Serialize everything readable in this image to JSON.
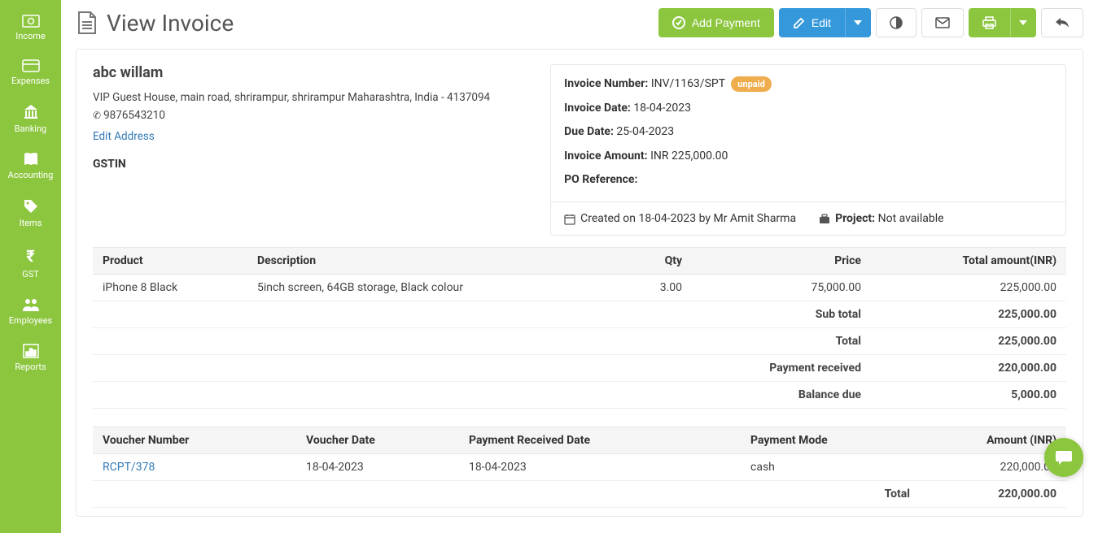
{
  "sidebar": {
    "items": [
      {
        "icon": "money",
        "label": "Income"
      },
      {
        "icon": "card",
        "label": "Expenses"
      },
      {
        "icon": "bank",
        "label": "Banking"
      },
      {
        "icon": "book",
        "label": "Accounting"
      },
      {
        "icon": "tag",
        "label": "Items"
      },
      {
        "icon": "rupee",
        "label": "GST"
      },
      {
        "icon": "users",
        "label": "Employees"
      },
      {
        "icon": "chart",
        "label": "Reports"
      }
    ]
  },
  "header": {
    "title": "View Invoice",
    "add_payment": "Add Payment",
    "edit": "Edit"
  },
  "customer": {
    "name": "abc willam",
    "address": "VIP Guest House, main road, shrirampur, shrirampur Maharashtra, India - 4137094",
    "phone": "9876543210",
    "edit_address": "Edit Address",
    "gstin_label": "GSTIN"
  },
  "invoice": {
    "number_label": "Invoice Number:",
    "number": "INV/1163/SPT",
    "status": "unpaid",
    "date_label": "Invoice Date:",
    "date": "18-04-2023",
    "due_label": "Due Date:",
    "due": "25-04-2023",
    "amount_label": "Invoice Amount:",
    "amount": "INR 225,000.00",
    "po_label": "PO Reference:",
    "po": "",
    "created_text": "Created on 18-04-2023 by Mr Amit Sharma",
    "project_label": "Project:",
    "project_value": "Not available"
  },
  "products": {
    "headers": {
      "product": "Product",
      "description": "Description",
      "qty": "Qty",
      "price": "Price",
      "total": "Total amount(INR)"
    },
    "rows": [
      {
        "product": "iPhone 8 Black",
        "description": "5inch screen, 64GB storage, Black colour",
        "qty": "3.00",
        "price": "75,000.00",
        "total": "225,000.00"
      }
    ],
    "summary": [
      {
        "label": "Sub total",
        "value": "225,000.00"
      },
      {
        "label": "Total",
        "value": "225,000.00"
      },
      {
        "label": "Payment received",
        "value": "220,000.00"
      },
      {
        "label": "Balance due",
        "value": "5,000.00"
      }
    ]
  },
  "vouchers": {
    "headers": {
      "number": "Voucher Number",
      "date": "Voucher Date",
      "received": "Payment Received Date",
      "mode": "Payment Mode",
      "amount": "Amount (INR)"
    },
    "rows": [
      {
        "number": "RCPT/378",
        "date": "18-04-2023",
        "received": "18-04-2023",
        "mode": "cash",
        "amount": "220,000.00"
      }
    ],
    "total_label": "Total",
    "total_value": "220,000.00"
  }
}
